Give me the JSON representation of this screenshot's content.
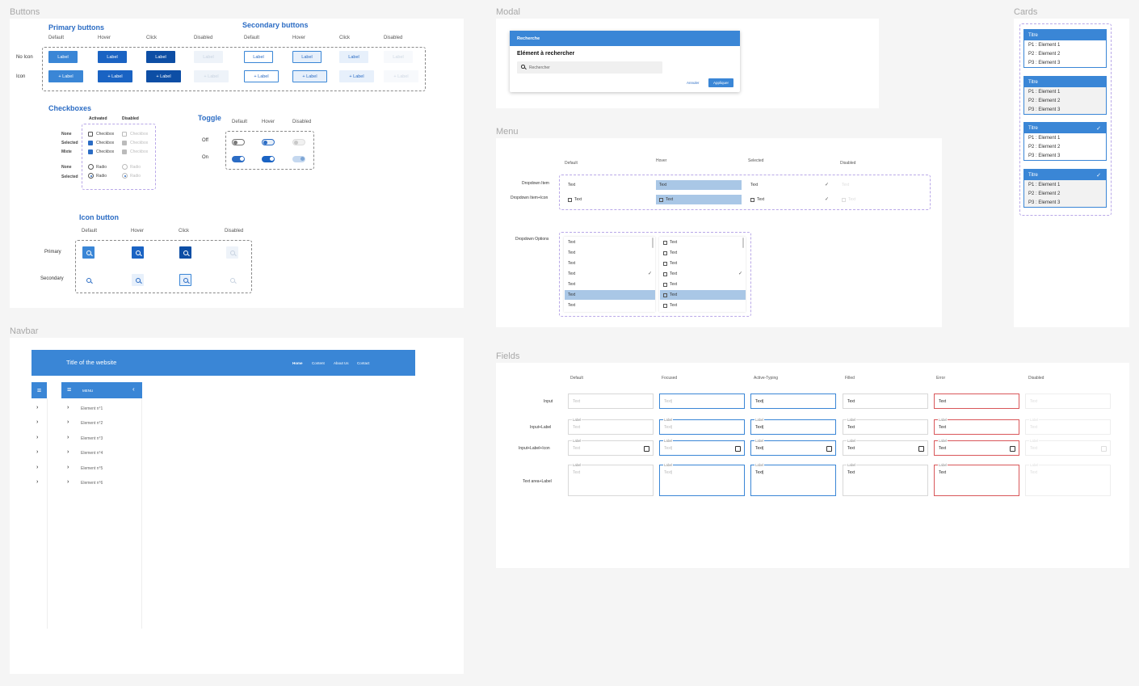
{
  "sections": {
    "buttons": "Buttons",
    "modal": "Modal",
    "cards": "Cards",
    "menu": "Menu",
    "navbar": "Navbar",
    "fields": "Fields"
  },
  "buttons": {
    "primary_title": "Primary buttons",
    "secondary_title": "Secondary buttons",
    "states": [
      "Default",
      "Hover",
      "Click",
      "Disabled"
    ],
    "row_no_icon": "No Icon",
    "row_icon": "Icon",
    "label": "Label",
    "icon_label": "+  Label"
  },
  "checkboxes": {
    "title": "Checkboxes",
    "col_activated": "Activated",
    "col_disabled": "Disabled",
    "rows": [
      "None",
      "Selected",
      "Mixte",
      "None",
      "Selected"
    ],
    "checkbox_text": "Checkbox",
    "radio_text": "Radio"
  },
  "toggle": {
    "title": "Toggle",
    "states": [
      "Default",
      "Hover",
      "Disabled"
    ],
    "row_off": "Off",
    "row_on": "On"
  },
  "icon_button": {
    "title": "Icon button",
    "states": [
      "Default",
      "Hover",
      "Click",
      "Disabled"
    ],
    "row_primary": "Primary",
    "row_secondary": "Secondary"
  },
  "navbar": {
    "site_title": "Title of the website",
    "links": [
      "Home",
      "Content",
      "About Us",
      "Contact"
    ],
    "menu_label": "MENU",
    "elements": [
      "Element n°1",
      "Element n°2",
      "Element n°3",
      "Element n°4",
      "Element n°5",
      "Element n°6"
    ]
  },
  "modal": {
    "header": "Recherche",
    "title": "Elément à rechercher",
    "search_placeholder": "Rechercher",
    "cancel": "Annuler",
    "apply": "Appliquer"
  },
  "menu": {
    "states": [
      "Default",
      "Hover",
      "Selected",
      "Disabled"
    ],
    "row_item": "Dropdown Item",
    "row_item_icon": "Dropdown Item+Icon",
    "row_options": "Dropdown Options",
    "text": "Text",
    "options": [
      "Text",
      "Text",
      "Text",
      "Text",
      "Text",
      "Text",
      "Text"
    ]
  },
  "fields": {
    "states": [
      "Default",
      "Focused",
      "Active-Typing",
      "Filled",
      "Error",
      "Disabled"
    ],
    "rows": [
      "Input",
      "Input+Label",
      "Input+Label+Icon",
      "Text area+Label"
    ],
    "text": "Text",
    "typing": "Text|",
    "label": "Label"
  },
  "cards": {
    "title": "Titre",
    "items": [
      "P1 : Element 1",
      "P2 : Element 2",
      "P3 : Element 3"
    ]
  },
  "colors": {
    "primary": "#3a86d6",
    "hover": "#1a63c3",
    "click": "#0d4ea5",
    "error": "#d9575a"
  }
}
